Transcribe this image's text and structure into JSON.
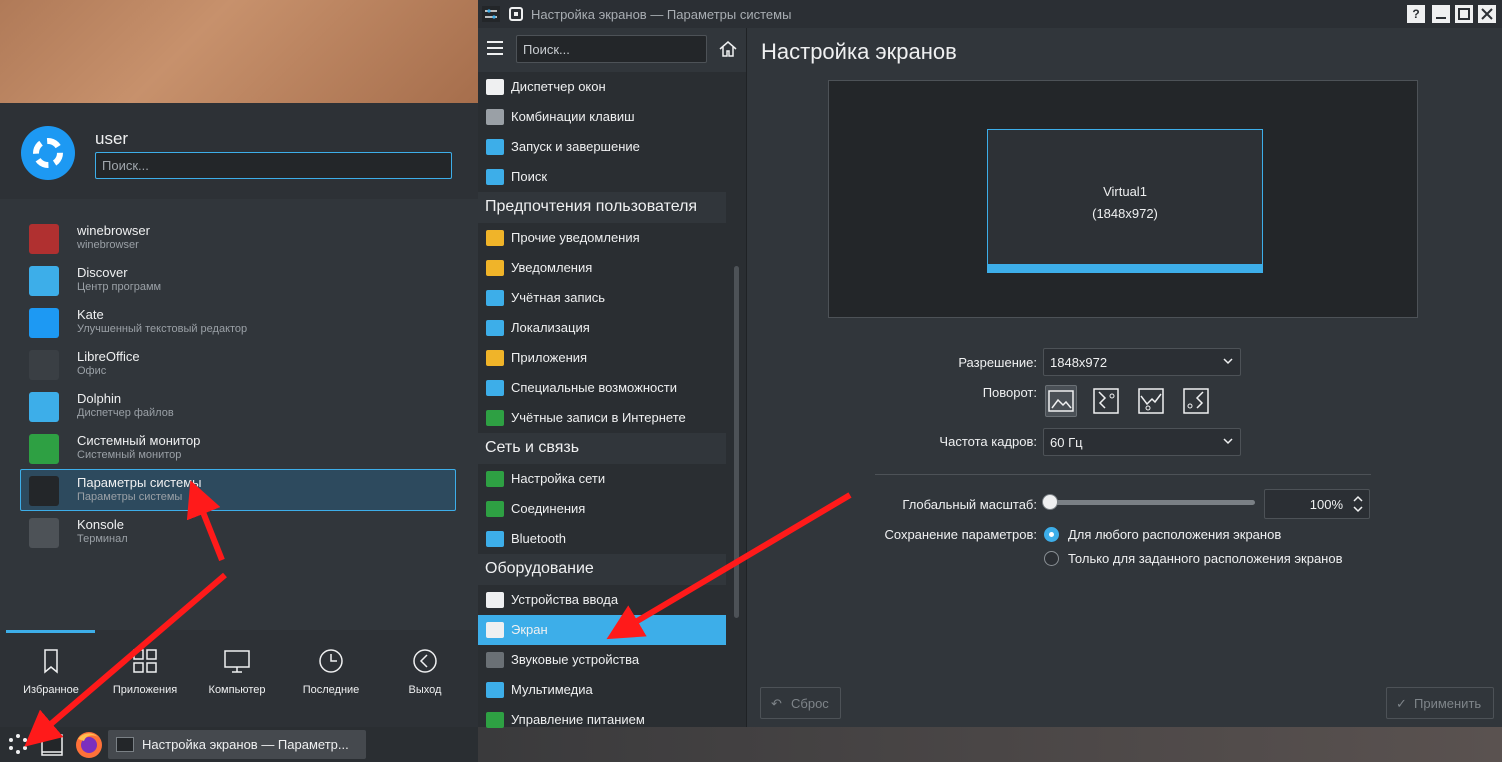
{
  "launcher": {
    "user_name": "user",
    "search_placeholder": "Поиск...",
    "apps": [
      {
        "name": "winebrowser",
        "desc": "winebrowser",
        "icon": "wine-glass-icon",
        "color": "#b03030"
      },
      {
        "name": "Discover",
        "desc": "Центр программ",
        "icon": "discover-bag-icon",
        "color": "#3daee9"
      },
      {
        "name": "Kate",
        "desc": "Улучшенный текстовый редактор",
        "icon": "kate-bird-icon",
        "color": "#1d99f3"
      },
      {
        "name": "LibreOffice",
        "desc": "Офис",
        "icon": "libreoffice-icon",
        "color": "#3a3f44"
      },
      {
        "name": "Dolphin",
        "desc": "Диспетчер файлов",
        "icon": "folder-icon",
        "color": "#3daee9"
      },
      {
        "name": "Системный монитор",
        "desc": "Системный монитор",
        "icon": "system-monitor-icon",
        "color": "#2ea043"
      },
      {
        "name": "Параметры системы",
        "desc": "Параметры системы",
        "icon": "settings-sliders-icon",
        "color": "#232629"
      },
      {
        "name": "Konsole",
        "desc": "Терминал",
        "icon": "terminal-icon",
        "color": "#4d5257"
      }
    ],
    "tabs": [
      {
        "label": "Избранное",
        "icon": "bookmark-icon"
      },
      {
        "label": "Приложения",
        "icon": "grid-icon"
      },
      {
        "label": "Компьютер",
        "icon": "monitor-icon"
      },
      {
        "label": "Последние",
        "icon": "clock-icon"
      },
      {
        "label": "Выход",
        "icon": "leave-icon"
      }
    ]
  },
  "taskbar": {
    "task_label": "Настройка экранов — Параметр..."
  },
  "window": {
    "title": "Настройка экранов — Параметры системы",
    "help_btn": "?",
    "sidebar": {
      "search_placeholder": "Поиск...",
      "items": [
        {
          "type": "item",
          "label": "Диспетчер окон",
          "icon": "window-icon",
          "color": "#eff0f1"
        },
        {
          "type": "item",
          "label": "Комбинации клавиш",
          "icon": "keyboard-icon",
          "color": "#9aa0a6"
        },
        {
          "type": "item",
          "label": "Запуск и завершение",
          "icon": "startup-icon",
          "color": "#3daee9"
        },
        {
          "type": "item",
          "label": "Поиск",
          "icon": "search-icon",
          "color": "#3daee9"
        },
        {
          "type": "category",
          "label": "Предпочтения пользователя"
        },
        {
          "type": "item",
          "label": "Прочие уведомления",
          "icon": "bell-icon",
          "color": "#f0b429"
        },
        {
          "type": "item",
          "label": "Уведомления",
          "icon": "bell-icon",
          "color": "#f0b429"
        },
        {
          "type": "item",
          "label": "Учётная запись",
          "icon": "user-account-icon",
          "color": "#3daee9"
        },
        {
          "type": "item",
          "label": "Локализация",
          "icon": "locale-icon",
          "color": "#3daee9"
        },
        {
          "type": "item",
          "label": "Приложения",
          "icon": "star-icon",
          "color": "#f0b429"
        },
        {
          "type": "item",
          "label": "Специальные возможности",
          "icon": "accessibility-icon",
          "color": "#3daee9"
        },
        {
          "type": "item",
          "label": "Учётные записи в Интернете",
          "icon": "globe-icon",
          "color": "#2ea043"
        },
        {
          "type": "category",
          "label": "Сеть и связь"
        },
        {
          "type": "item",
          "label": "Настройка сети",
          "icon": "globe-icon",
          "color": "#2ea043"
        },
        {
          "type": "item",
          "label": "Соединения",
          "icon": "globe-icon",
          "color": "#2ea043"
        },
        {
          "type": "item",
          "label": "Bluetooth",
          "icon": "bluetooth-icon",
          "color": "#3daee9"
        },
        {
          "type": "category",
          "label": "Оборудование"
        },
        {
          "type": "item",
          "label": "Устройства ввода",
          "icon": "keyboard-icon",
          "color": "#eff0f1"
        },
        {
          "type": "item",
          "label": "Экран",
          "icon": "display-icon",
          "color": "#eff0f1",
          "active": true
        },
        {
          "type": "item",
          "label": "Звуковые устройства",
          "icon": "speaker-icon",
          "color": "#6a7075"
        },
        {
          "type": "item",
          "label": "Мультимедиа",
          "icon": "multimedia-icon",
          "color": "#3daee9"
        },
        {
          "type": "item",
          "label": "Управление питанием",
          "icon": "power-icon",
          "color": "#2ea043"
        }
      ]
    },
    "content": {
      "page_title": "Настройка экранов",
      "monitor_name": "Virtual1",
      "monitor_res": "(1848x972)",
      "resolution_label": "Разрешение:",
      "resolution_value": "1848x972",
      "rotation_label": "Поворот:",
      "refresh_label": "Частота кадров:",
      "refresh_value": "60 Гц",
      "scale_label": "Глобальный масштаб:",
      "scale_value": "100%",
      "scale_slider_fraction": 0.0,
      "save_label": "Сохранение параметров:",
      "save_options": [
        "Для любого расположения экранов",
        "Только для заданного расположения экранов"
      ],
      "save_selected": 0,
      "reset_label": "Сброс",
      "apply_label": "Применить"
    }
  },
  "colors": {
    "accent": "#3daee9",
    "annotation": "#ff1a1a"
  }
}
